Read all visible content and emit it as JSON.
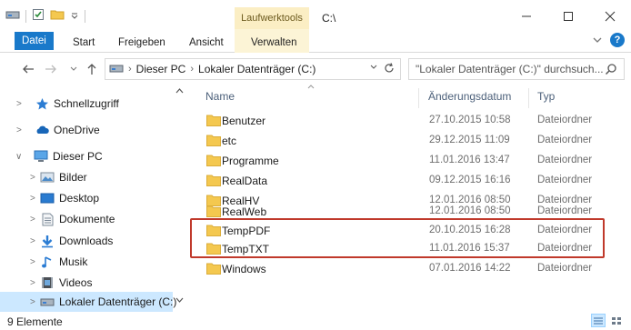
{
  "window": {
    "context_tab": "Laufwerktools",
    "title": "C:\\",
    "minimize": "—",
    "maximize": "☐",
    "close": "✕"
  },
  "ribbon": {
    "tabs": [
      "Datei",
      "Start",
      "Freigeben",
      "Ansicht",
      "Verwalten"
    ],
    "accent": "#1979ca",
    "context_color": "#fbeec4"
  },
  "address": {
    "crumbs": [
      "Dieser PC",
      "Lokaler Datenträger (C:)"
    ],
    "search_placeholder": "\"Lokaler Datenträger (C:)\" durchsuch..."
  },
  "nav": {
    "items": [
      {
        "label": "Schnellzugriff",
        "icon": "star-icon",
        "expander": ">"
      },
      {
        "label": "OneDrive",
        "icon": "cloud-icon",
        "expander": ">"
      },
      {
        "label": "Dieser PC",
        "icon": "computer-icon",
        "expander": "∨"
      },
      {
        "label": "Bilder",
        "icon": "pictures-icon",
        "expander": ">"
      },
      {
        "label": "Desktop",
        "icon": "desktop-icon",
        "expander": ">"
      },
      {
        "label": "Dokumente",
        "icon": "documents-icon",
        "expander": ">"
      },
      {
        "label": "Downloads",
        "icon": "download-icon",
        "expander": ">"
      },
      {
        "label": "Musik",
        "icon": "music-icon",
        "expander": ">"
      },
      {
        "label": "Videos",
        "icon": "video-icon",
        "expander": ">"
      },
      {
        "label": "Lokaler Datenträger (C:)",
        "icon": "drive-icon",
        "expander": ">",
        "selected": true
      }
    ],
    "selected_color": "#cce8ff"
  },
  "columns": {
    "name": "Name",
    "date": "Änderungsdatum",
    "type": "Typ"
  },
  "files": [
    {
      "name": "Benutzer",
      "date": "27.10.2015 10:58",
      "type": "Dateiordner"
    },
    {
      "name": "etc",
      "date": "29.12.2015 11:09",
      "type": "Dateiordner"
    },
    {
      "name": "Programme",
      "date": "11.01.2016 13:47",
      "type": "Dateiordner"
    },
    {
      "name": "RealData",
      "date": "09.12.2015 16:16",
      "type": "Dateiordner"
    },
    {
      "name": "RealHV",
      "date": "12.01.2016 08:50",
      "type": "Dateiordner"
    },
    {
      "name": "RealWeb",
      "date": "12.01.2016 08:50",
      "type": "Dateiordner"
    },
    {
      "name": "TempPDF",
      "date": "20.10.2015 16:28",
      "type": "Dateiordner"
    },
    {
      "name": "TempTXT",
      "date": "11.01.2016 15:37",
      "type": "Dateiordner"
    },
    {
      "name": "Windows",
      "date": "07.01.2016 14:22",
      "type": "Dateiordner"
    }
  ],
  "folder_color": "#f4c84f",
  "highlight_color": "#c0392b",
  "status": {
    "count": "9 Elemente"
  }
}
